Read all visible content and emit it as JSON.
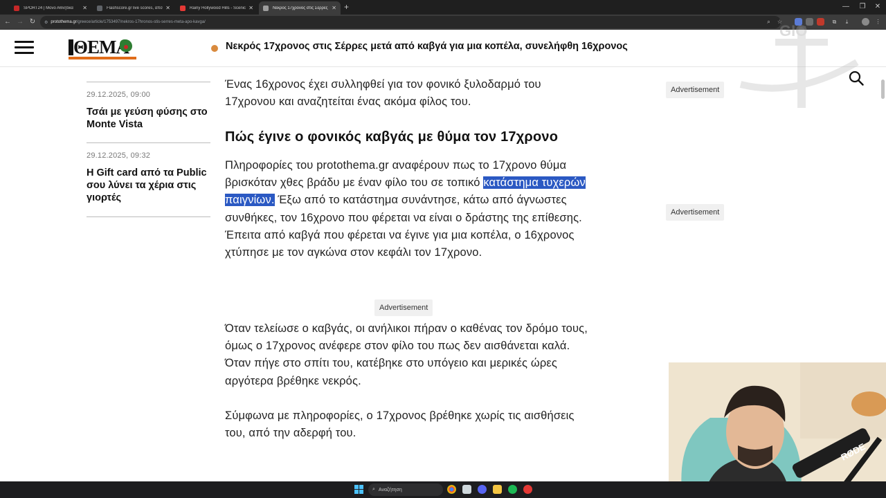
{
  "browser": {
    "tabs": [
      {
        "label": "SPORT24 | Μόνο Αθλητικά",
        "color": "#c62828"
      },
      {
        "label": "Flashscore.gr live scores, αποτε",
        "color": "#5f6368"
      },
      {
        "label": "Rainy Hollywood Hills - Scenic",
        "color": "#e53935"
      },
      {
        "label": "Νεκρός 17χρονος στις Σέρρες",
        "color": "#9e9e9e",
        "active": true
      }
    ],
    "close_glyph": "✕",
    "new_tab_glyph": "+",
    "url_host": "protothema.gr",
    "url_path": "/greece/article/1753497/nekros-17hronos-stis-serres-meta-apo-kavga/"
  },
  "site": {
    "logo_text": "ΘΕΜΑ",
    "breaking_headline": "Νεκρός 17χρονος στις Σέρρες μετά από καβγά για μια κοπέλα, συνελήφθη 16χρονος",
    "accent_color": "#e06c1a"
  },
  "sidebar": {
    "items": [
      {
        "date": "29.12.2025, 09:00",
        "title": "Τσάι με γεύση φύσης στο Monte Vista"
      },
      {
        "date": "29.12.2025, 09:32",
        "title": "Η Gift card από τα Public σου λύνει τα χέρια στις γιορτές"
      }
    ]
  },
  "article": {
    "p1": "Ένας 16χρονος έχει συλληφθεί για τον φονικό ξυλοδαρμό του 17χρονου και αναζητείται ένας ακόμα φίλος του.",
    "heading": "Πώς έγινε ο φονικός καβγάς με θύμα τον 17χρονο",
    "p2_before": "Πληροφορίες του protothema.gr αναφέρουν πως το 17χρονο θύμα  βρισκόταν χθες βράδυ με έναν φίλο του σε τοπικό ",
    "p2_selected": "κατάστημα τυχερών παιγνίων.",
    "p2_after": " Έξω από το κατάστημα συνάντησε, κάτω από άγνωστες συνθήκες,  τον 16χρονο που φέρεται να είναι ο δράστης της επίθεσης. Έπειτα από καβγά που φέρεται να έγινε για μια κοπέλα, ο 16χρονος χτύπησε με τον αγκώνα στον κεφάλι τον 17χρονο.",
    "ad_label": "Advertisement",
    "p3": "Όταν τελείωσε ο καβγάς, οι ανήλικοι πήραν ο καθένας τον δρόμο τους, όμως ο 17χρονος ανέφερε στον φίλο του πως δεν αισθάνεται καλά. Όταν πήγε στο σπίτι του, κατέβηκε στο υπόγειο και μερικές ώρες αργότερα βρέθηκε νεκρός.",
    "p4": "Σύμφωνα με πληροφορίες, ο 17χρονος βρέθηκε χωρίς τις αισθήσεις του, από την αδερφή του."
  },
  "right_rail": {
    "ad_label_1": "Advertisement",
    "ad_label_2": "Advertisement"
  },
  "overlay": {
    "watermark_text": "GIO",
    "mic_brand": "RØDE"
  },
  "taskbar": {
    "search_label": "Αναζήτηση"
  }
}
